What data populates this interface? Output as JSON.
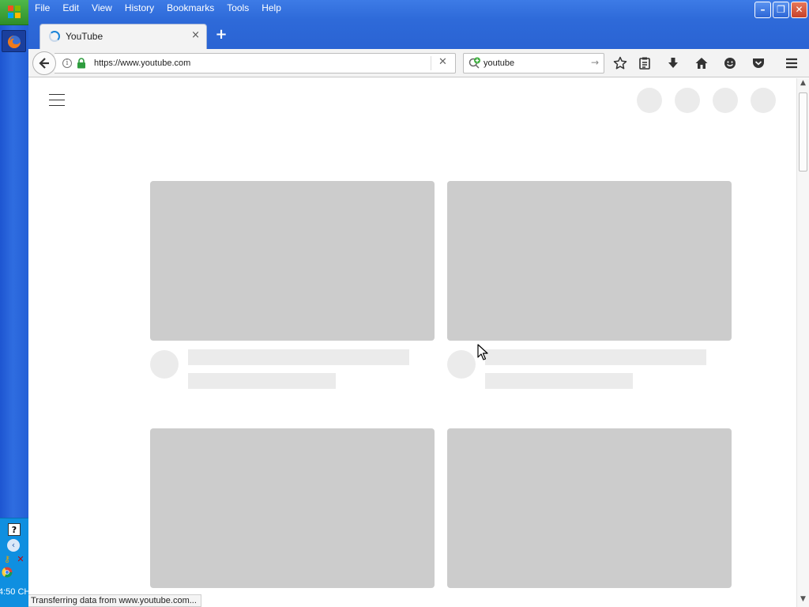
{
  "menubar": {
    "items": [
      "File",
      "Edit",
      "View",
      "History",
      "Bookmarks",
      "Tools",
      "Help"
    ]
  },
  "window_controls": {
    "minimize": "–",
    "restore": "❐",
    "close": "✕"
  },
  "tab": {
    "title": "YouTube",
    "close_glyph": "×",
    "new_tab_glyph": "+"
  },
  "urlbar": {
    "url": "https://www.youtube.com",
    "stop_glyph": "✕",
    "info_glyph": "i"
  },
  "searchbar": {
    "value": "youtube",
    "go_glyph": "→"
  },
  "statusbar": {
    "text": "Transferring data from www.youtube.com..."
  },
  "taskbar": {
    "clock": "4:50 CH",
    "help_glyph": "?"
  },
  "colors": {
    "title_bar": "#2e6ad9",
    "placeholder_thumb": "#cccccc",
    "placeholder_line": "#ebebeb",
    "lock_green": "#2e9c3e"
  }
}
